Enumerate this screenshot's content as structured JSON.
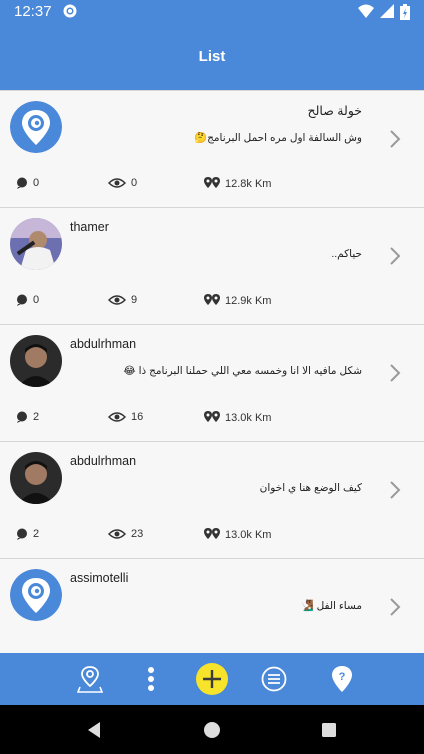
{
  "status_bar": {
    "time": "12:37"
  },
  "header": {
    "title": "List"
  },
  "items": [
    {
      "name": "خولة صالح",
      "message": "وش السالفة اول مره احمل البرنامج🤔",
      "comments": "0",
      "views": "0",
      "distance": "12.8k Km",
      "avatar": "pin-logo"
    },
    {
      "name": "thamer",
      "message": "حياكم..",
      "comments": "0",
      "views": "9",
      "distance": "12.9k Km",
      "avatar": "photo"
    },
    {
      "name": "abdulrhman",
      "message": "شكل مافيه الا انا وخمسه معي اللي حملنا البرنامج ذا 😂",
      "comments": "2",
      "views": "16",
      "distance": "13.0k Km",
      "avatar": "photo"
    },
    {
      "name": "abdulrhman",
      "message": "كيف الوضع هنا ي اخوان",
      "comments": "2",
      "views": "23",
      "distance": "13.0k Km",
      "avatar": "photo"
    },
    {
      "name": "assimotelli",
      "message": "مساء الفل 🧏🏾‍♂️",
      "comments": "",
      "views": "",
      "distance": "",
      "avatar": "pin-logo"
    }
  ],
  "bottom_nav": [
    "map-pin-icon",
    "more-vertical-icon",
    "add-icon",
    "list-icon",
    "help-pin-icon"
  ],
  "colors": {
    "primary": "#4a88d9",
    "accent": "#f6e32a"
  }
}
